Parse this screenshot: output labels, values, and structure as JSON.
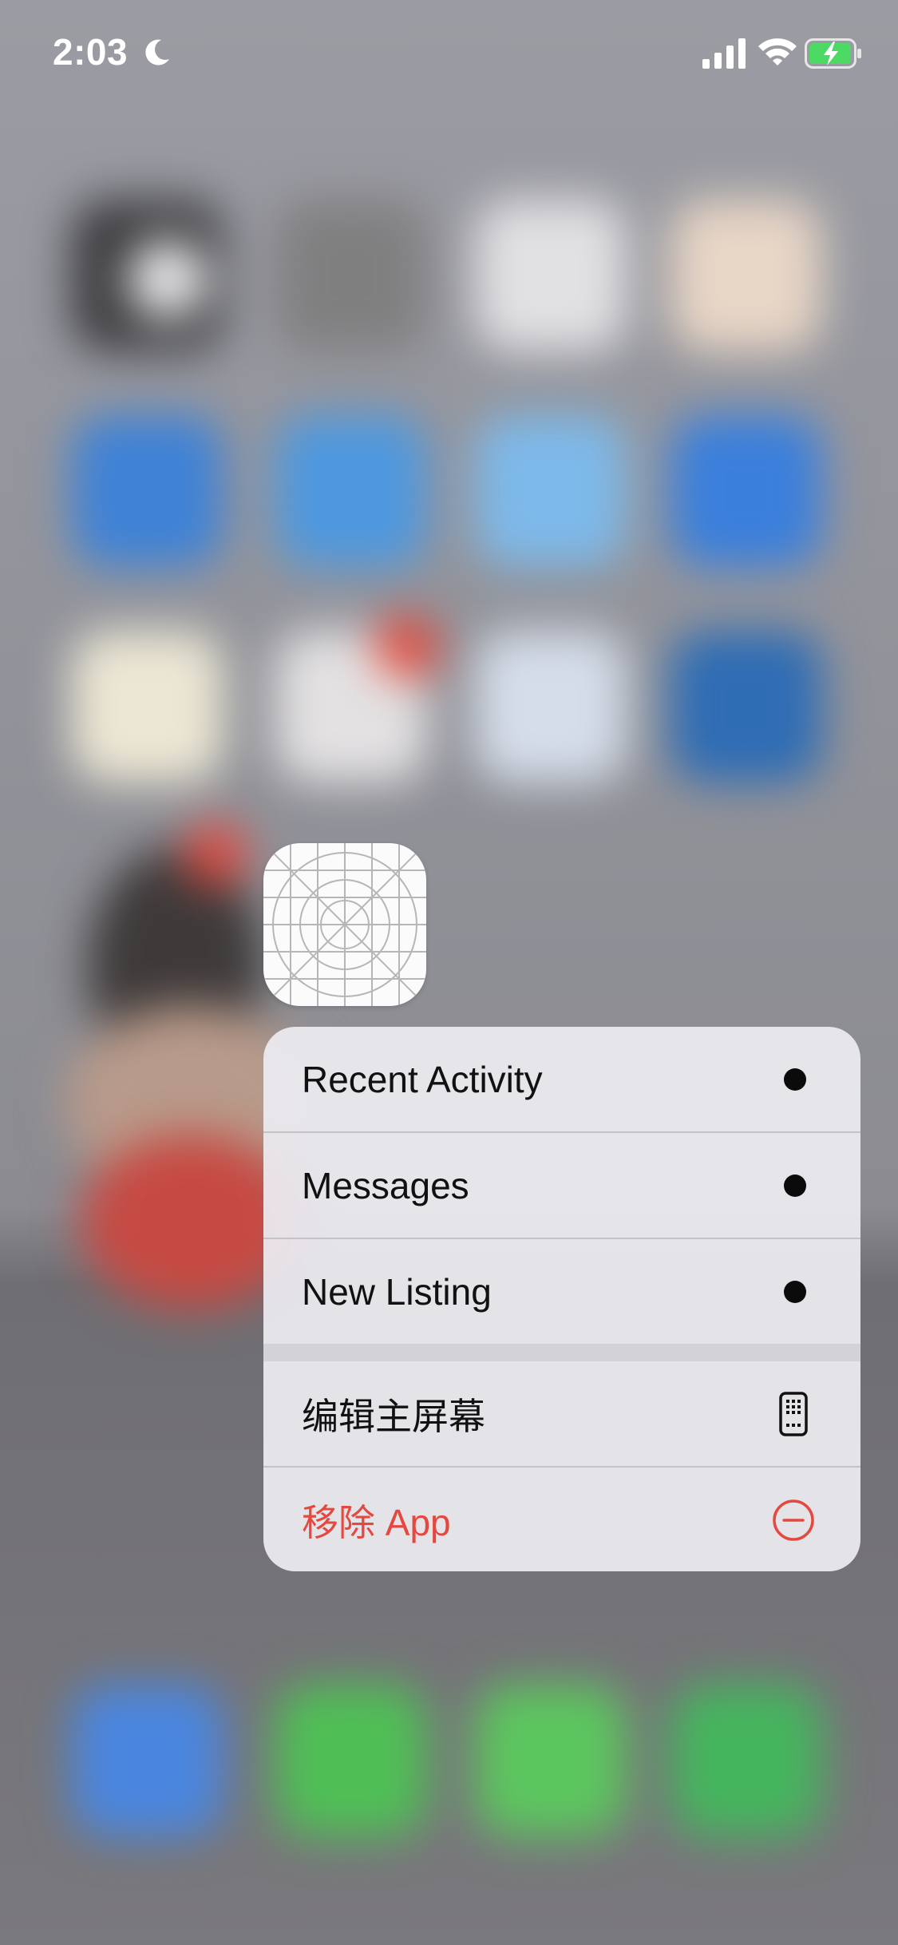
{
  "status_bar": {
    "time": "2:03",
    "icons": [
      "moon-icon",
      "cellular-signal-icon",
      "wifi-icon",
      "battery-charging-icon"
    ]
  },
  "app_icon": {
    "icon": "app-placeholder-grid-icon"
  },
  "context_menu": {
    "items": [
      {
        "label": "Recent Activity",
        "icon": "bullet-dot-icon"
      },
      {
        "label": "Messages",
        "icon": "bullet-dot-icon"
      },
      {
        "label": "New Listing",
        "icon": "bullet-dot-icon"
      }
    ],
    "system_items": [
      {
        "label": "编辑主屏幕",
        "icon": "phone-screen-icon"
      },
      {
        "label": "移除 App",
        "icon": "minus-circle-icon",
        "color": "#e5483f"
      }
    ]
  },
  "colors": {
    "menu_background": "#ecebf0",
    "destructive": "#e5483f",
    "battery_green": "#4cd964"
  }
}
